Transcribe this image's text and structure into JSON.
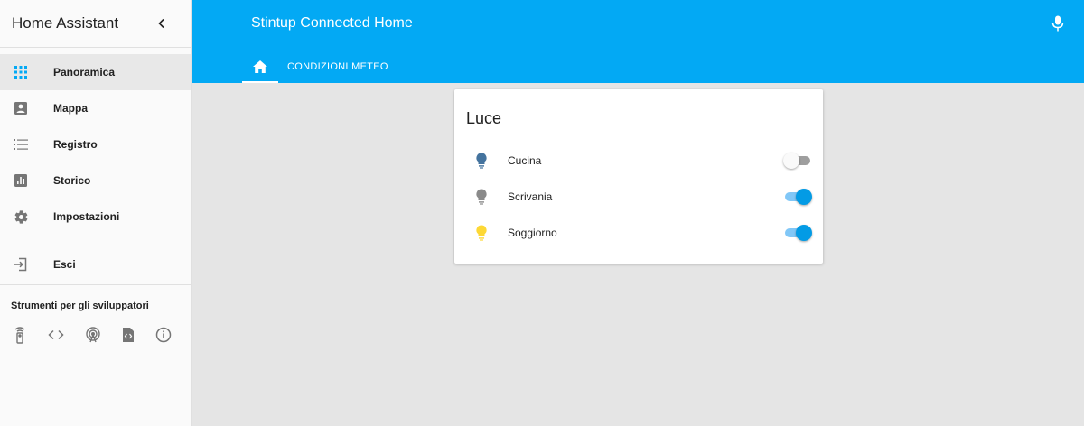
{
  "sidebar": {
    "title": "Home Assistant",
    "items": [
      {
        "label": "Panoramica",
        "icon": "apps-grid-icon",
        "active": true
      },
      {
        "label": "Mappa",
        "icon": "map-account-icon",
        "active": false
      },
      {
        "label": "Registro",
        "icon": "list-icon",
        "active": false
      },
      {
        "label": "Storico",
        "icon": "chart-icon",
        "active": false
      },
      {
        "label": "Impostazioni",
        "icon": "gear-icon",
        "active": false
      }
    ],
    "logout_label": "Esci",
    "dev_tools_title": "Strumenti per gli sviluppatori",
    "dev_tools": [
      "remote-icon",
      "code-icon",
      "broadcast-icon",
      "file-code-icon",
      "info-icon"
    ]
  },
  "header": {
    "title": "Stintup Connected Home",
    "tabs": [
      {
        "icon": "home-icon",
        "active": true
      },
      {
        "label": "CONDIZIONI METEO",
        "active": false
      }
    ]
  },
  "card": {
    "title": "Luce",
    "entities": [
      {
        "name": "Cucina",
        "state": "off",
        "icon_color": "#44739e"
      },
      {
        "name": "Scrivania",
        "state": "on",
        "icon_color": "#8a8a8a"
      },
      {
        "name": "Soggiorno",
        "state": "on",
        "icon_color": "#fdd835"
      }
    ]
  },
  "colors": {
    "primary": "#03a9f4",
    "toggle_on": "#039be5",
    "sidebar_icon_active": "#03a9f4",
    "sidebar_icon": "#757575"
  }
}
